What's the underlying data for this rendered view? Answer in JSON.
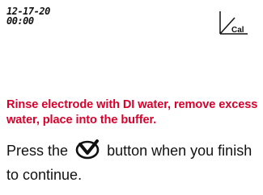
{
  "status": {
    "date": "12-17-20",
    "time": "00:00"
  },
  "icons": {
    "calibration": "calibration-icon",
    "continue": "continue-arrow-icon"
  },
  "calibration_label": "Cal",
  "instruction": {
    "warning_text": "Rinse electrode with DI water, remove excess water, place into the buffer.",
    "press_prefix": "Press the",
    "press_suffix": "button when you finish to continue."
  },
  "colors": {
    "warning": "#d9002b",
    "text": "#111111",
    "background": "#ffffff"
  }
}
